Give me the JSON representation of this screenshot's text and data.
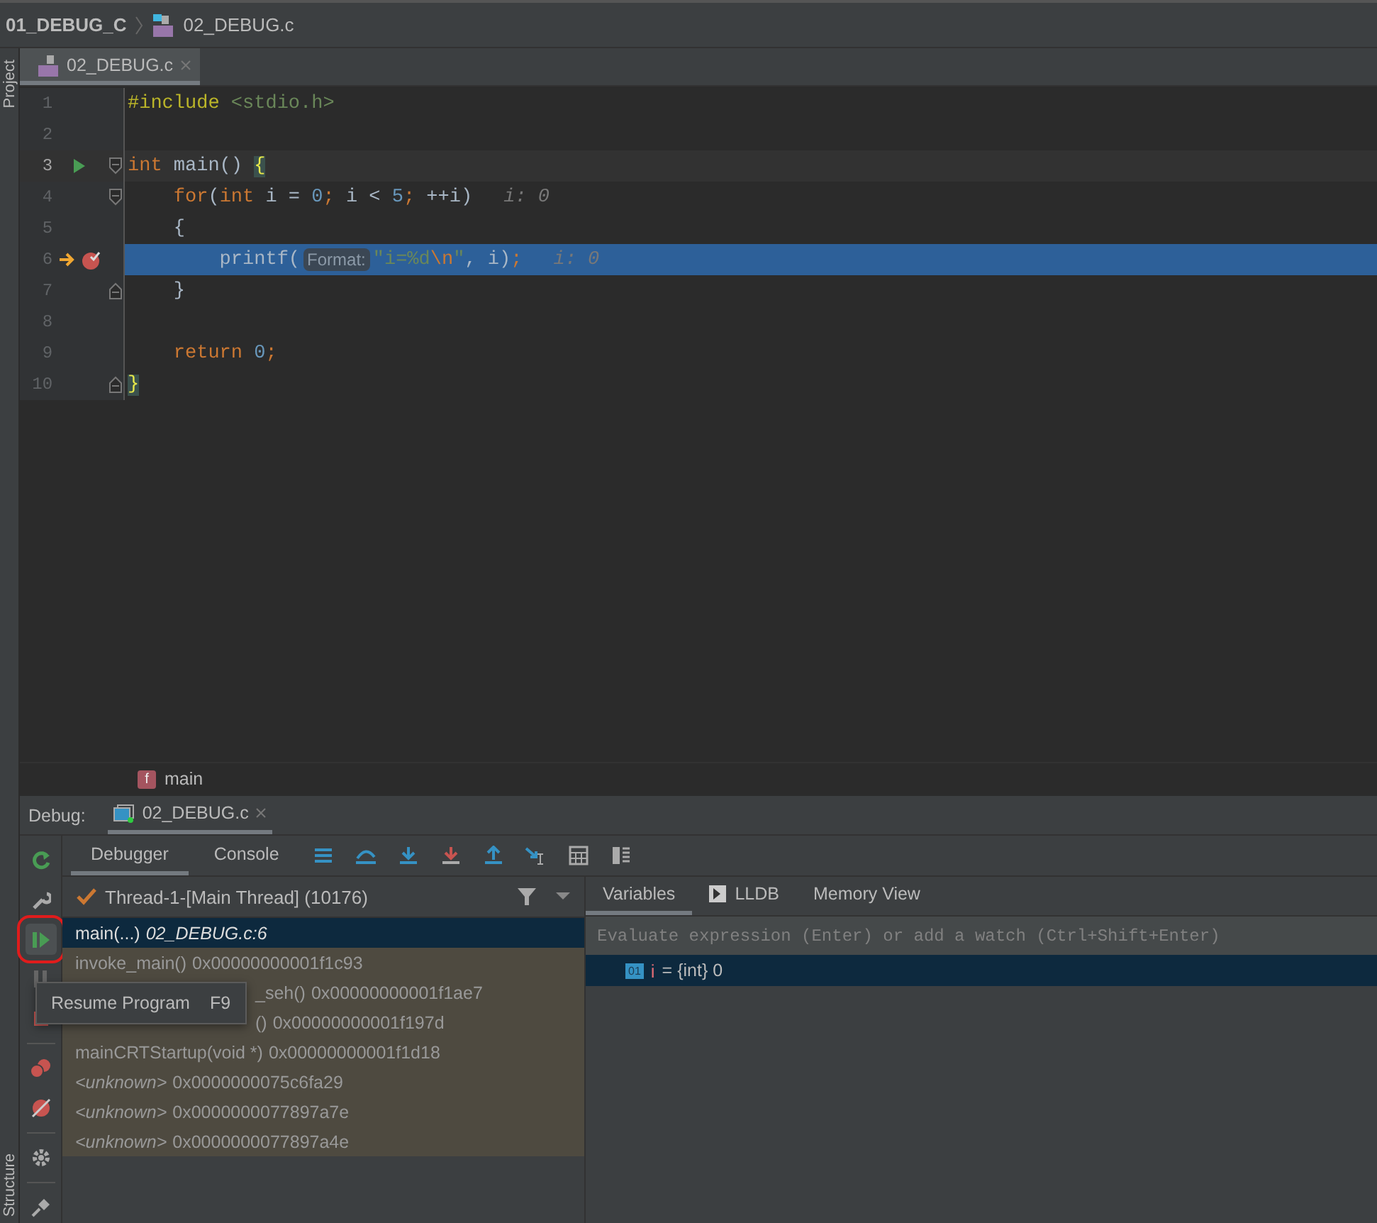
{
  "breadcrumb": {
    "project": "01_DEBUG_C",
    "file": "02_DEBUG.c"
  },
  "left_tool_windows": [
    {
      "label": "Project"
    },
    {
      "label": "Structure"
    }
  ],
  "editor_tabs": [
    {
      "label": "02_DEBUG.c",
      "selected": true
    }
  ],
  "code_lines": [
    {
      "number": "1",
      "caret_line": false,
      "execution_point": false,
      "tokens": [
        {
          "kind": "macro",
          "text": "#include "
        },
        {
          "kind": "include",
          "text": "<stdio.h>"
        }
      ]
    },
    {
      "number": "2",
      "caret_line": false,
      "execution_point": false
    },
    {
      "number": "3",
      "run_icon": true,
      "fold_start": true,
      "caret_line": true,
      "execution_point": false,
      "tokens": [
        {
          "kind": "keyword",
          "text": "int "
        },
        {
          "kind": "plain",
          "text": "main() "
        },
        {
          "kind": "brace",
          "text": "{"
        }
      ]
    },
    {
      "number": "4",
      "fold_start": true,
      "caret_line": false,
      "execution_point": false,
      "tokens": [
        {
          "kind": "keyword",
          "text": "    for"
        },
        {
          "kind": "plain",
          "text": "("
        },
        {
          "kind": "keyword",
          "text": "int "
        },
        {
          "kind": "plain",
          "text": "i = "
        },
        {
          "kind": "number",
          "text": "0"
        },
        {
          "kind": "keyword",
          "text": "; "
        },
        {
          "kind": "plain",
          "text": "i < "
        },
        {
          "kind": "number",
          "text": "5"
        },
        {
          "kind": "keyword",
          "text": "; "
        },
        {
          "kind": "plain",
          "text": "++i)"
        },
        {
          "kind": "debug_value",
          "text": "i: 0"
        }
      ]
    },
    {
      "number": "5",
      "caret_line": false,
      "execution_point": false,
      "tokens": [
        {
          "kind": "plain",
          "text": "    {"
        }
      ]
    },
    {
      "number": "6",
      "breakpoint": true,
      "caret_line": false,
      "execution_point": true,
      "tokens": [
        {
          "kind": "plain",
          "text": "        printf("
        },
        {
          "kind": "param_hint",
          "text": "Format:"
        },
        {
          "kind": "string",
          "text": "\"i=%d"
        },
        {
          "kind": "escape",
          "text": "\\n"
        },
        {
          "kind": "string",
          "text": "\""
        },
        {
          "kind": "plain",
          "text": ", i)"
        },
        {
          "kind": "keyword",
          "text": ";"
        },
        {
          "kind": "debug_value",
          "text": "i: 0"
        }
      ]
    },
    {
      "number": "7",
      "fold_end": true,
      "caret_line": false,
      "execution_point": false,
      "tokens": [
        {
          "kind": "plain",
          "text": "    }"
        }
      ]
    },
    {
      "number": "8",
      "caret_line": false,
      "execution_point": false
    },
    {
      "number": "9",
      "caret_line": false,
      "execution_point": false,
      "tokens": [
        {
          "kind": "keyword",
          "text": "    return "
        },
        {
          "kind": "number",
          "text": "0"
        },
        {
          "kind": "keyword",
          "text": ";"
        }
      ]
    },
    {
      "number": "10",
      "fold_end": true,
      "caret_line": false,
      "execution_point": false,
      "tokens": [
        {
          "kind": "brace",
          "text": "}"
        }
      ]
    }
  ],
  "editor_breadcrumb": {
    "badge": "f",
    "label": "main"
  },
  "debug": {
    "label": "Debug:",
    "session_tab": {
      "label": "02_DEBUG.c",
      "selected": true
    },
    "tabs": [
      {
        "label": "Debugger",
        "selected": true
      },
      {
        "label": "Console",
        "selected": false
      }
    ],
    "thread": "Thread-1-[Main Thread] (10176)",
    "frames": [
      {
        "kind": "current",
        "name": "main(...)",
        "location": "02_DEBUG.c:6",
        "selected": true
      },
      {
        "kind": "frame",
        "name": "invoke_main()",
        "location": "0x00000000001f1c93",
        "selected": false
      },
      {
        "kind": "partial",
        "name": "_seh()",
        "location": "0x00000000001f1ae7",
        "selected": false
      },
      {
        "kind": "partial",
        "name": "()",
        "location": "0x00000000001f197d",
        "selected": false
      },
      {
        "kind": "frame",
        "name": "mainCRTStartup(void *)",
        "location": "0x00000000001f1d18",
        "selected": false
      },
      {
        "kind": "unknown",
        "name": "<unknown>",
        "location": "0x0000000075c6fa29",
        "selected": false
      },
      {
        "kind": "unknown",
        "name": "<unknown>",
        "location": "0x0000000077897a7e",
        "selected": false
      },
      {
        "kind": "unknown",
        "name": "<unknown>",
        "location": "0x0000000077897a4e",
        "selected": false
      }
    ],
    "variable_tabs": [
      {
        "label": "Variables",
        "selected": true
      },
      {
        "label": "LLDB",
        "selected": false
      },
      {
        "label": "Memory View",
        "selected": false
      }
    ],
    "evaluate": {
      "placeholder": "Evaluate expression (Enter) or add a watch (Ctrl+Shift+Enter)"
    },
    "variables": [
      {
        "badge": "01",
        "name": "i",
        "value": "= {int} 0",
        "selected": true
      }
    ],
    "tooltip": {
      "label": "Resume Program",
      "shortcut": "F9"
    }
  }
}
